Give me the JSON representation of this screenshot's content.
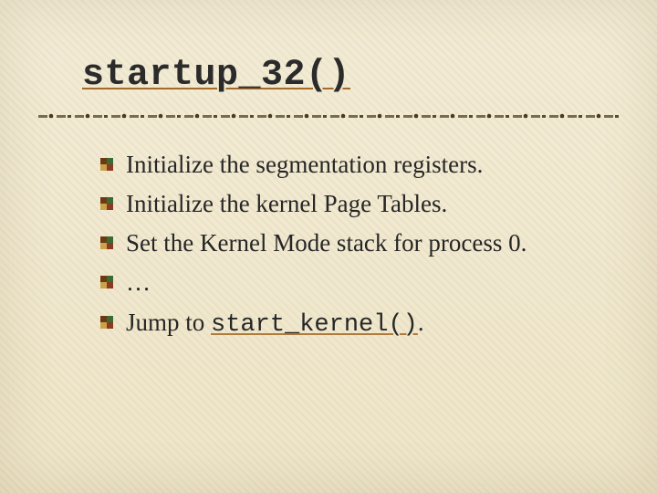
{
  "title": "startup_32()",
  "bullets": {
    "b1": "Initialize the segmentation registers.",
    "b2": "Initialize the kernel Page Tables.",
    "b3": "Set the Kernel Mode stack for process 0.",
    "b4": "…",
    "b5_prefix": "Jump to ",
    "b5_code": "start_kernel()",
    "b5_suffix": "."
  }
}
